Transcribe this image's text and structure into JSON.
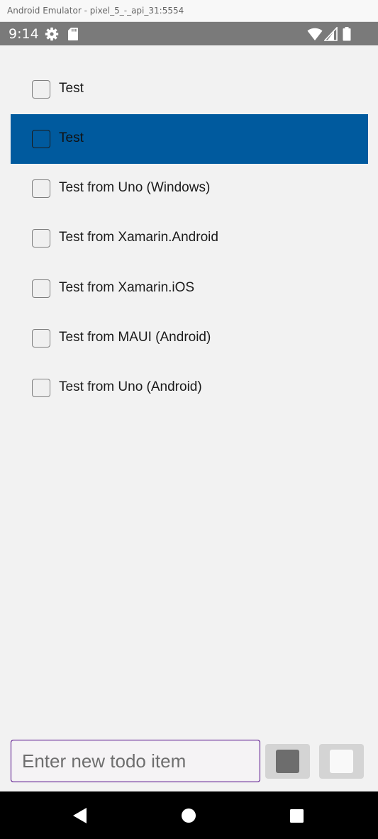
{
  "window": {
    "title": "Android Emulator - pixel_5_-_api_31:5554"
  },
  "status_bar": {
    "time": "9:14",
    "left_icons": [
      "gear-icon",
      "sd-card-icon"
    ],
    "right_icons": [
      "wifi-icon",
      "signal-icon",
      "battery-icon"
    ]
  },
  "todo_list": {
    "items": [
      {
        "label": "Test",
        "checked": false,
        "selected": false
      },
      {
        "label": "Test",
        "checked": false,
        "selected": true
      },
      {
        "label": "Test from Uno (Windows)",
        "checked": false,
        "selected": false
      },
      {
        "label": "Test from Xamarin.Android",
        "checked": false,
        "selected": false
      },
      {
        "label": "Test from Xamarin.iOS",
        "checked": false,
        "selected": false
      },
      {
        "label": "Test from MAUI (Android)",
        "checked": false,
        "selected": false
      },
      {
        "label": "Test from Uno (Android)",
        "checked": false,
        "selected": false
      }
    ]
  },
  "new_item": {
    "value": "",
    "placeholder": "Enter new todo item"
  },
  "buttons": {
    "first_icon": "filled-square-icon",
    "second_icon": "empty-square-icon"
  },
  "nav_bar": {
    "icons": [
      "back-icon",
      "home-icon",
      "recents-icon"
    ]
  },
  "colors": {
    "selection": "#005a9e",
    "status_bar": "#7a7a7a",
    "input_border": "#4b0082",
    "background": "#f2f2f2"
  }
}
